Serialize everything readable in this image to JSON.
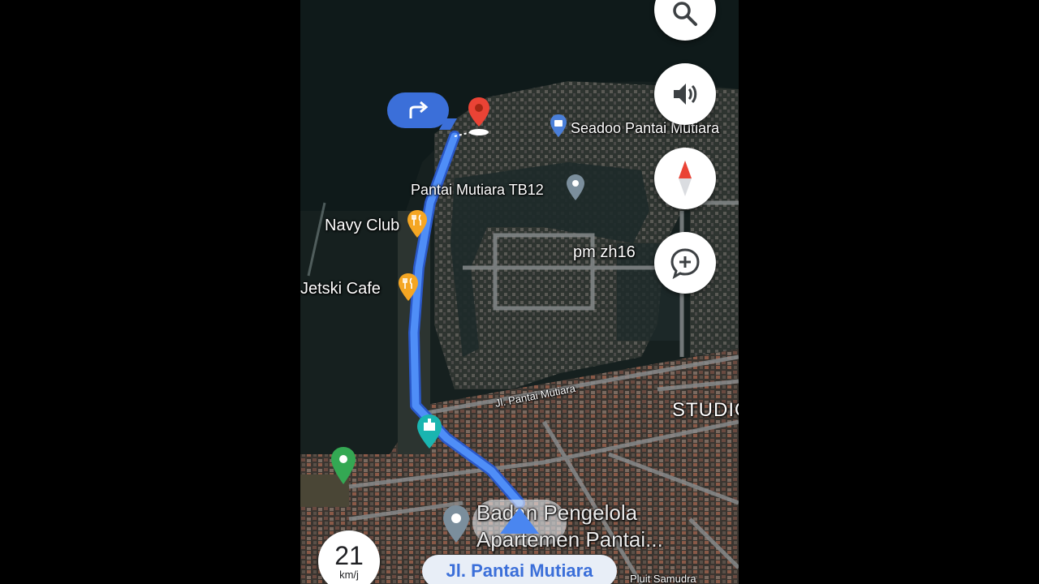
{
  "map": {
    "labels": {
      "seadoo": "Seadoo Pantai Mutiara",
      "tb12": "Pantai Mutiara TB12",
      "navy_club": "Navy Club",
      "pm_zh16": "pm zh16",
      "jetski_cafe": "Jetski Cafe",
      "street_name": "Jl. Pantai Mutiara",
      "district": "STUDIO",
      "badan": "Badan Pengelola",
      "apartemen": "Apartemen Pantai...",
      "pluit": "Pluit Samudra"
    }
  },
  "controls": {
    "search_icon": "search-icon",
    "volume_icon": "volume-icon",
    "compass_icon": "compass-icon",
    "report_icon": "add-report-icon"
  },
  "turn": {
    "icon": "turn-right-arrow-icon"
  },
  "speed": {
    "value": "21",
    "unit": "km/j"
  },
  "current_street": "Jl. Pantai Mutiara",
  "colors": {
    "route": "#4285f4",
    "turn_bubble": "#3b6fd9",
    "destination_pin": "#ea4335",
    "food_pin": "#f5a623",
    "teal_pin": "#1ab5b0",
    "green_pin": "#34a853"
  }
}
